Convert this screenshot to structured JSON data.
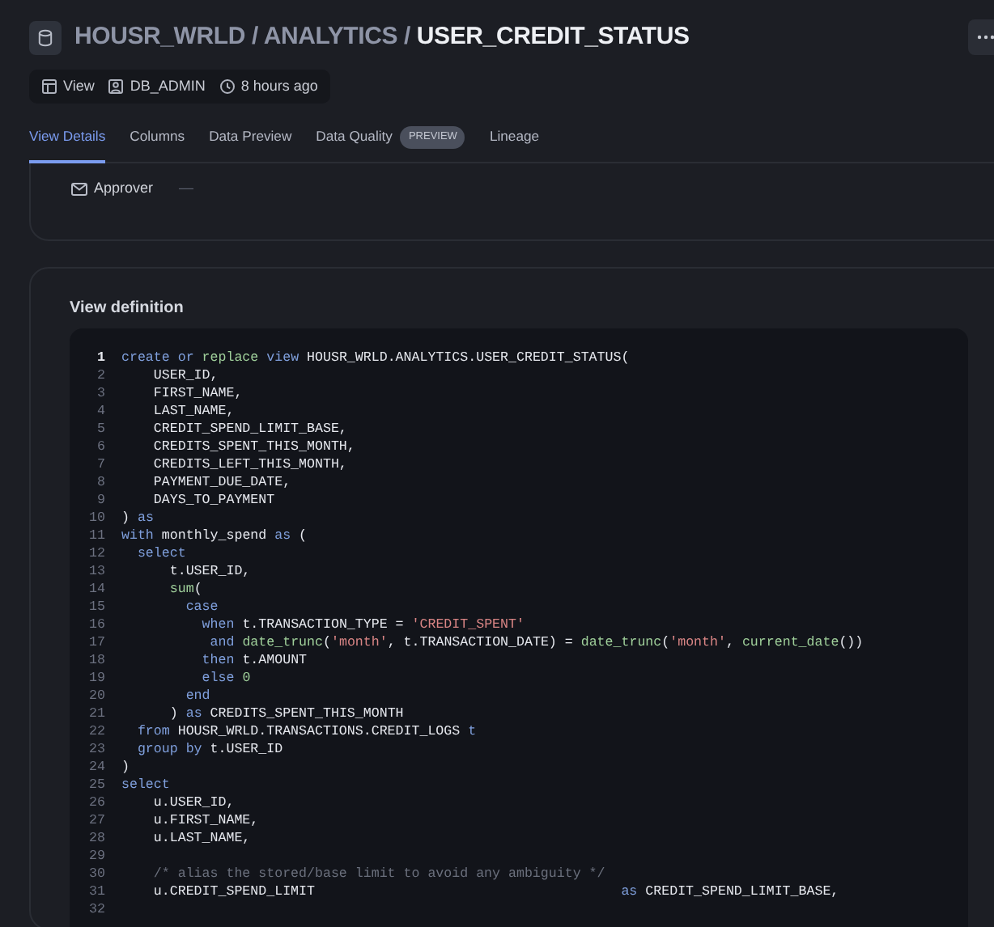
{
  "breadcrumb": [
    {
      "text": "HOUSR_WRLD",
      "current": false
    },
    {
      "text": "ANALYTICS",
      "current": false
    },
    {
      "text": "USER_CREDIT_STATUS",
      "current": true
    }
  ],
  "separator": "/",
  "meta": [
    {
      "kind": "view",
      "text": "View"
    },
    {
      "kind": "owner",
      "text": "DB_ADMIN"
    },
    {
      "kind": "time",
      "text": "8 hours ago"
    }
  ],
  "tabs": [
    {
      "label": "View Details",
      "selected": true
    },
    {
      "label": "Columns",
      "selected": false
    },
    {
      "label": "Data Preview",
      "selected": false
    },
    {
      "label": "Data Quality",
      "selected": false,
      "badge": "PREVIEW"
    },
    {
      "label": "Lineage",
      "selected": false
    }
  ],
  "approver": {
    "label": "Approver",
    "value": "—"
  },
  "definition": {
    "title": "View definition",
    "lines": [
      {
        "n": "1",
        "active": true,
        "tokens": [
          {
            "kind": "kw",
            "text": "create"
          },
          {
            "kind": "kw",
            "text": " or"
          },
          {
            "kind": "fn",
            "text": " replace"
          },
          {
            "kind": "kw",
            "text": " view"
          },
          {
            "kind": "plain",
            "text": " HOUSR_WRLD.ANALYTICS.USER_CREDIT_STATUS("
          }
        ]
      },
      {
        "n": "2",
        "active": false,
        "tokens": [
          {
            "kind": "plain",
            "text": "    USER_ID,"
          }
        ]
      },
      {
        "n": "3",
        "active": false,
        "tokens": [
          {
            "kind": "plain",
            "text": "    FIRST_NAME,"
          }
        ]
      },
      {
        "n": "4",
        "active": false,
        "tokens": [
          {
            "kind": "plain",
            "text": "    LAST_NAME,"
          }
        ]
      },
      {
        "n": "5",
        "active": false,
        "tokens": [
          {
            "kind": "plain",
            "text": "    CREDIT_SPEND_LIMIT_BASE,"
          }
        ]
      },
      {
        "n": "6",
        "active": false,
        "tokens": [
          {
            "kind": "plain",
            "text": "    CREDITS_SPENT_THIS_MONTH,"
          }
        ]
      },
      {
        "n": "7",
        "active": false,
        "tokens": [
          {
            "kind": "plain",
            "text": "    CREDITS_LEFT_THIS_MONTH,"
          }
        ]
      },
      {
        "n": "8",
        "active": false,
        "tokens": [
          {
            "kind": "plain",
            "text": "    PAYMENT_DUE_DATE,"
          }
        ]
      },
      {
        "n": "9",
        "active": false,
        "tokens": [
          {
            "kind": "plain",
            "text": "    DAYS_TO_PAYMENT"
          }
        ]
      },
      {
        "n": "10",
        "active": false,
        "tokens": [
          {
            "kind": "plain",
            "text": ") "
          },
          {
            "kind": "kw",
            "text": "as"
          }
        ]
      },
      {
        "n": "11",
        "active": false,
        "tokens": [
          {
            "kind": "kw",
            "text": "with"
          },
          {
            "kind": "plain",
            "text": " monthly_spend "
          },
          {
            "kind": "kw",
            "text": "as"
          },
          {
            "kind": "plain",
            "text": " ("
          }
        ]
      },
      {
        "n": "12",
        "active": false,
        "tokens": [
          {
            "kind": "kw",
            "text": "  select"
          }
        ]
      },
      {
        "n": "13",
        "active": false,
        "tokens": [
          {
            "kind": "plain",
            "text": "      t.USER_ID,"
          }
        ]
      },
      {
        "n": "14",
        "active": false,
        "tokens": [
          {
            "kind": "fn",
            "text": "      sum"
          },
          {
            "kind": "plain",
            "text": "("
          }
        ]
      },
      {
        "n": "15",
        "active": false,
        "tokens": [
          {
            "kind": "kw",
            "text": "        case"
          }
        ]
      },
      {
        "n": "16",
        "active": false,
        "tokens": [
          {
            "kind": "kw",
            "text": "          when"
          },
          {
            "kind": "plain",
            "text": " t.TRANSACTION_TYPE = "
          },
          {
            "kind": "str",
            "text": "'CREDIT_SPENT'"
          }
        ]
      },
      {
        "n": "17",
        "active": false,
        "tokens": [
          {
            "kind": "kw",
            "text": "           and"
          },
          {
            "kind": "fn",
            "text": " date_trunc"
          },
          {
            "kind": "plain",
            "text": "("
          },
          {
            "kind": "str",
            "text": "'month'"
          },
          {
            "kind": "plain",
            "text": ", t.TRANSACTION_DATE) = "
          },
          {
            "kind": "fn",
            "text": "date_trunc"
          },
          {
            "kind": "plain",
            "text": "("
          },
          {
            "kind": "str",
            "text": "'month'"
          },
          {
            "kind": "plain",
            "text": ", "
          },
          {
            "kind": "fn",
            "text": "current_date"
          },
          {
            "kind": "plain",
            "text": "())"
          }
        ]
      },
      {
        "n": "18",
        "active": false,
        "tokens": [
          {
            "kind": "kw",
            "text": "          then"
          },
          {
            "kind": "plain",
            "text": " t.AMOUNT"
          }
        ]
      },
      {
        "n": "19",
        "active": false,
        "tokens": [
          {
            "kind": "kw",
            "text": "          else"
          },
          {
            "kind": "num",
            "text": " 0"
          }
        ]
      },
      {
        "n": "20",
        "active": false,
        "tokens": [
          {
            "kind": "kw",
            "text": "        end"
          }
        ]
      },
      {
        "n": "21",
        "active": false,
        "tokens": [
          {
            "kind": "plain",
            "text": "      ) "
          },
          {
            "kind": "kw",
            "text": "as"
          },
          {
            "kind": "plain",
            "text": " CREDITS_SPENT_THIS_MONTH"
          }
        ]
      },
      {
        "n": "22",
        "active": false,
        "tokens": [
          {
            "kind": "kw",
            "text": "  from"
          },
          {
            "kind": "plain",
            "text": " HOUSR_WRLD.TRANSACTIONS.CREDIT_LOGS"
          },
          {
            "kind": "kw",
            "text": " t"
          }
        ]
      },
      {
        "n": "23",
        "active": false,
        "tokens": [
          {
            "kind": "kw",
            "text": "  group by"
          },
          {
            "kind": "plain",
            "text": " t.USER_ID"
          }
        ]
      },
      {
        "n": "24",
        "active": false,
        "tokens": [
          {
            "kind": "plain",
            "text": ")"
          }
        ]
      },
      {
        "n": "25",
        "active": false,
        "tokens": [
          {
            "kind": "kw",
            "text": "select"
          }
        ]
      },
      {
        "n": "26",
        "active": false,
        "tokens": [
          {
            "kind": "plain",
            "text": "    u.USER_ID,"
          }
        ]
      },
      {
        "n": "27",
        "active": false,
        "tokens": [
          {
            "kind": "plain",
            "text": "    u.FIRST_NAME,"
          }
        ]
      },
      {
        "n": "28",
        "active": false,
        "tokens": [
          {
            "kind": "plain",
            "text": "    u.LAST_NAME,"
          }
        ]
      },
      {
        "n": "29",
        "active": false
      },
      {
        "n": "30",
        "active": false,
        "tokens": [
          {
            "kind": "comment",
            "text": "    /* alias the stored/base limit to avoid any ambiguity */"
          }
        ]
      },
      {
        "n": "31",
        "active": false,
        "tokens": [
          {
            "kind": "plain",
            "text": "    u.CREDIT_SPEND_LIMIT                                      "
          },
          {
            "kind": "kw",
            "text": "as"
          },
          {
            "kind": "plain",
            "text": " CREDIT_SPEND_LIMIT_BASE,"
          }
        ]
      },
      {
        "n": "32",
        "active": false
      }
    ]
  }
}
